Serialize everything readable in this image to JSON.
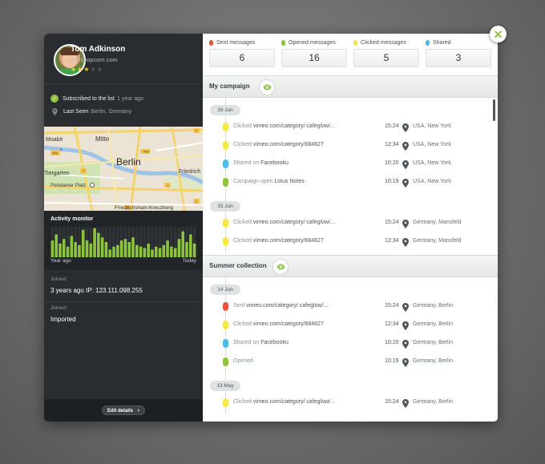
{
  "profile": {
    "name": "Tom Adkinson",
    "email": "tom@opcom.com",
    "stars_on": "★★★",
    "stars_off": "★★",
    "rating": 3,
    "rating_max": 5
  },
  "info": {
    "subscribed_label": "Subscribed to the list",
    "subscribed_when": "1 year ago",
    "last_seen_label": "Last Seen",
    "last_seen_value": "Berlin, Germany"
  },
  "map": {
    "labels": {
      "moabit": "Moabit",
      "mitte": "Mitte",
      "berlin": "Berlin",
      "tiergarten": "Tiergarten",
      "friedrich": "Friedrich",
      "potsdamer": "Potsdamer Platz",
      "friedrichshain": "Friedrichshain-Kreuzberg",
      "road_96a": "96a",
      "road_2": "2",
      "road_1": "1",
      "road_2b": "2",
      "road_96a_2": "96a",
      "road_5": "5",
      "road_2c": "2",
      "road_1b": "1"
    }
  },
  "activity": {
    "title": "Activity monitor",
    "left_label": "Year ago",
    "right_label": "Today",
    "bars": [
      0.55,
      0.75,
      0.45,
      0.6,
      0.35,
      0.7,
      0.5,
      0.4,
      0.9,
      0.55,
      0.45,
      0.95,
      0.8,
      0.65,
      0.5,
      0.25,
      0.35,
      0.4,
      0.55,
      0.6,
      0.5,
      0.65,
      0.4,
      0.35,
      0.3,
      0.45,
      0.25,
      0.35,
      0.3,
      0.4,
      0.55,
      0.35,
      0.3,
      0.6,
      0.85,
      0.5,
      0.75,
      0.45
    ]
  },
  "joined": [
    {
      "label": "Joined:",
      "value": "3 years ago IP: 123.111.098.255"
    },
    {
      "label": "Joined:",
      "value": "Imported"
    }
  ],
  "edit_button": "Edit details",
  "edit_arrow": "›",
  "close_glyph": "✕",
  "check_glyph": "✓",
  "stats": [
    {
      "label": "Sent messages",
      "value": "6",
      "color": "#e9553a"
    },
    {
      "label": "Opened messages",
      "value": "16",
      "color": "#8cc43f"
    },
    {
      "label": "Clicked messages",
      "value": "5",
      "color": "#f5e94a"
    },
    {
      "label": "Shared",
      "value": "3",
      "color": "#4fb9e8"
    }
  ],
  "colors": {
    "accent_green": "#8cc43f",
    "sent_red": "#e9553a",
    "opened_green": "#8cc43f",
    "clicked_yellow": "#f5e94a",
    "shared_blue": "#4fb9e8"
  },
  "campaigns": [
    {
      "title": "My campaign",
      "groups": [
        {
          "date": "16 Jun",
          "events": [
            {
              "type": "clicked",
              "action": "Clicked",
              "target": "vimeo.com/category/ cafeglow/...",
              "time": "15:24",
              "location": "USA, New York"
            },
            {
              "type": "clicked",
              "action": "Clicked",
              "target": "vimeo.com/category/684627",
              "time": "12:34",
              "location": "USA, New York"
            },
            {
              "type": "shared",
              "action": "Shared on",
              "target": "Facebooku",
              "time": "10:20",
              "location": "USA, New York"
            },
            {
              "type": "opened",
              "action": "Campaign open",
              "target": "Lotus Notes",
              "time": "10:19",
              "location": "USA, New York"
            }
          ]
        },
        {
          "date": "15 Jun",
          "events": [
            {
              "type": "clicked",
              "action": "Clicked",
              "target": "vimeo.com/category/ cafeglow/...",
              "time": "15:24",
              "location": "Germany, Mansfeld"
            },
            {
              "type": "clicked",
              "action": "Clicked",
              "target": "vimeo.com/category/684627",
              "time": "12:34",
              "location": "Germany, Mansfeld"
            }
          ]
        }
      ]
    },
    {
      "title": "Summer collection",
      "groups": [
        {
          "date": "14 Jun",
          "events": [
            {
              "type": "sent",
              "action": "Sent",
              "target": "vimeo.com/category/ cafeglow/...",
              "time": "15:24",
              "location": "Germany, Berlin"
            },
            {
              "type": "clicked",
              "action": "Clicked",
              "target": "vimeo.com/category/684627",
              "time": "12:34",
              "location": "Germany, Berlin"
            },
            {
              "type": "shared",
              "action": "Shared on",
              "target": "Facebooku",
              "time": "10:20",
              "location": "Germany, Berlin"
            },
            {
              "type": "opened",
              "action": "Opened",
              "target": "",
              "time": "10:19",
              "location": "Germany, Berlin"
            }
          ]
        },
        {
          "date": "13 May",
          "events": [
            {
              "type": "clicked",
              "action": "Clicked",
              "target": "vimeo.com/category/ cafeglow/...",
              "time": "15:24",
              "location": "Germany, Berlin"
            }
          ]
        }
      ]
    }
  ]
}
